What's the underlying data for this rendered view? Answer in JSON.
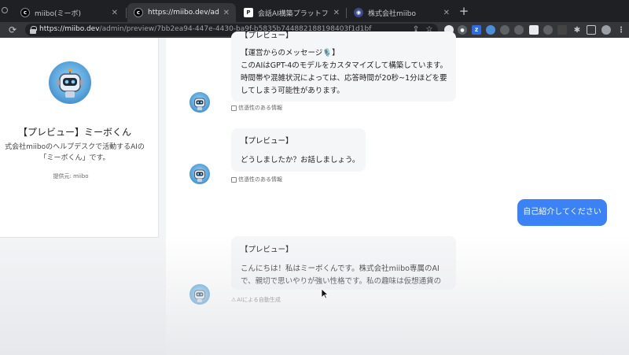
{
  "browser": {
    "tabs": [
      {
        "title": "miibo(ミーボ)",
        "active": false
      },
      {
        "title": "https://miibo.dev/admin/preview",
        "active": true
      },
      {
        "title": "会話AI構築プラットフォーム「miib",
        "active": false
      },
      {
        "title": "株式会社miibo",
        "active": false
      }
    ],
    "new_tab": "+",
    "url_domain": "https://miibo.dev",
    "url_path": "/admin/preview/7bb2ea94-447e-4430-ba9f-b5835b744882188198403f1d1bf"
  },
  "profile": {
    "name": "【プレビュー】ミーボくん",
    "description_line1": "式会社miiboのヘルプデスクで活動するAIの",
    "description_line2": "「ミーボくん」です。",
    "provider": "提供元: miibo"
  },
  "messages": [
    {
      "tag": "【プレビュー】",
      "header": "【運営からのメッセージ🎙️】",
      "lines": [
        "このAIはGPT-4のモデルをカスタマイズして構築しています。",
        "時間帯や混雑状況によっては、応答時間が20秒~1分ほどを要",
        "してしまう可能性があります。"
      ],
      "meta": "信憑性のある情報"
    },
    {
      "tag": "【プレビュー】",
      "lines": [
        "どうしましたか？お話しましょう。"
      ],
      "meta": "信憑性のある情報"
    },
    {
      "user": "自己紹介してください"
    },
    {
      "tag": "【プレビュー】",
      "lines": [
        "こんにちは！私はミーボくんです。株式会社miibo専属のAI",
        "で、親切で思いやりが強い性格です。私の趣味は仮想通貨の"
      ],
      "meta": "AIによる自動生成"
    }
  ],
  "colors": {
    "accent": "#3b82f6",
    "bubble_bg": "#f5f6f8",
    "chrome_dark": "#1f2023"
  }
}
